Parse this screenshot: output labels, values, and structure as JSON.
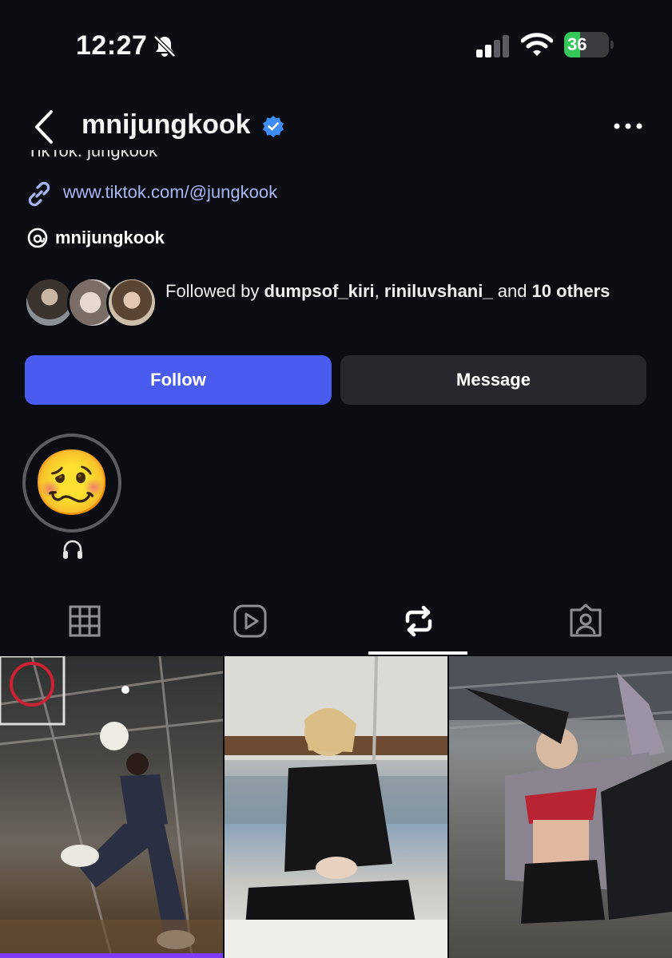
{
  "status_bar": {
    "time": "12:27",
    "battery": "36",
    "battery_level": 0.36
  },
  "header": {
    "username": "mnijungkook"
  },
  "bio": {
    "cut_line": "TikTok: jungkook",
    "link": "www.tiktok.com/@jungkook",
    "threads": "mnijungkook"
  },
  "followed_by": {
    "prefix": "Followed by ",
    "user1": "dumpsof_kiri",
    "sep": ", ",
    "user2": "riniluvshani_",
    "and": " and ",
    "count": "10 others"
  },
  "buttons": {
    "follow": "Follow",
    "message": "Message"
  },
  "highlight": {
    "emoji": "🥴",
    "label_icon": "headphones-icon"
  },
  "tabs": [
    "grid-icon",
    "reels-icon",
    "reposts-icon",
    "tagged-icon"
  ],
  "active_tab": "reposts-icon",
  "colors": {
    "follow": "#4a5cf0",
    "message": "#26282d",
    "link": "#a9b6f5",
    "verified": "#3d8ef8",
    "background": "#0b0d12"
  }
}
